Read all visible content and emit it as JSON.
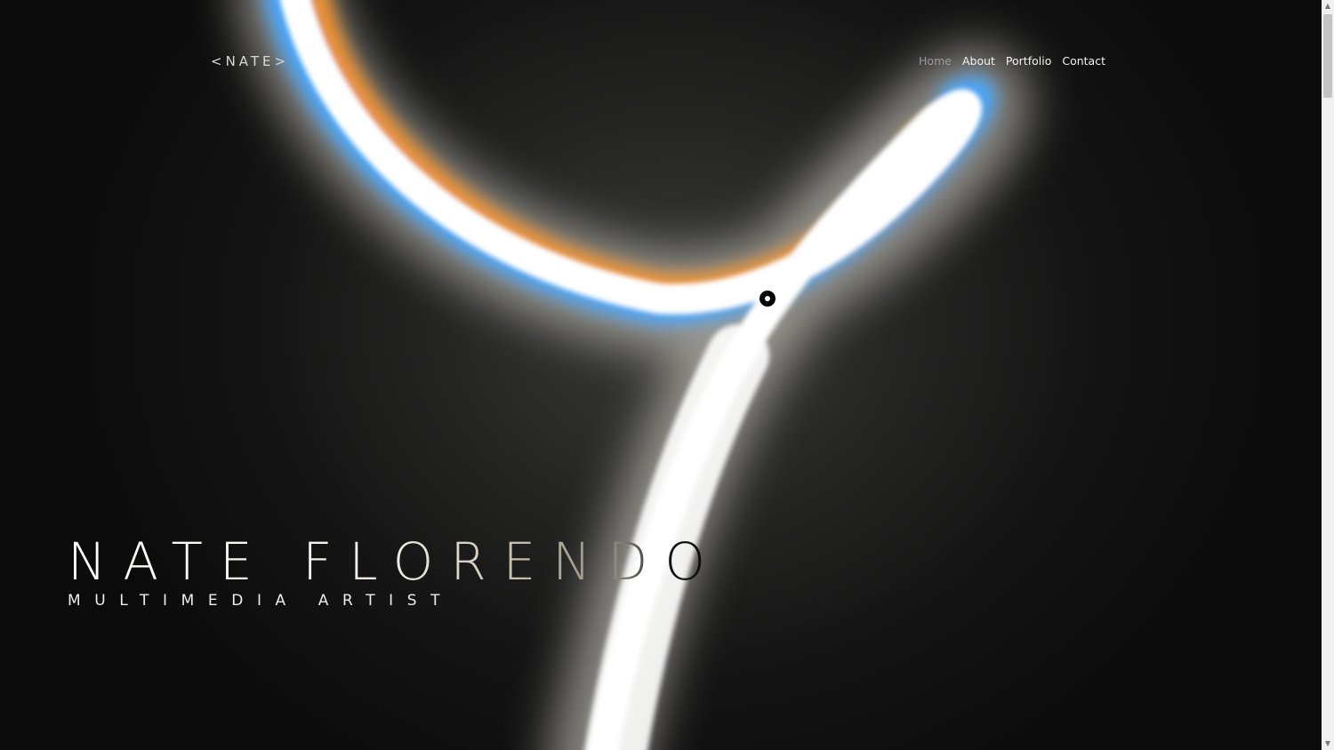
{
  "header": {
    "logo_text": "<NATE>",
    "nav": [
      {
        "label": "Home",
        "active": true
      },
      {
        "label": "About",
        "active": false
      },
      {
        "label": "Portfolio",
        "active": false
      },
      {
        "label": "Contact",
        "active": false
      }
    ]
  },
  "hero": {
    "title": "NATE FLORENDO",
    "subtitle": "MULTIMEDIA ARTIST"
  },
  "colors": {
    "background": "#0b0b0b",
    "nav_active": "#9c9c9c",
    "nav_text": "#f2f2f2",
    "light_trail": "#ffffff",
    "trail_blue": "#5ab4ff",
    "trail_orange": "#ff9a2a"
  },
  "icons": {
    "cursor": "circular-cursor-icon",
    "scroll_up": "chevron-up-icon",
    "scroll_down": "chevron-down-icon"
  }
}
